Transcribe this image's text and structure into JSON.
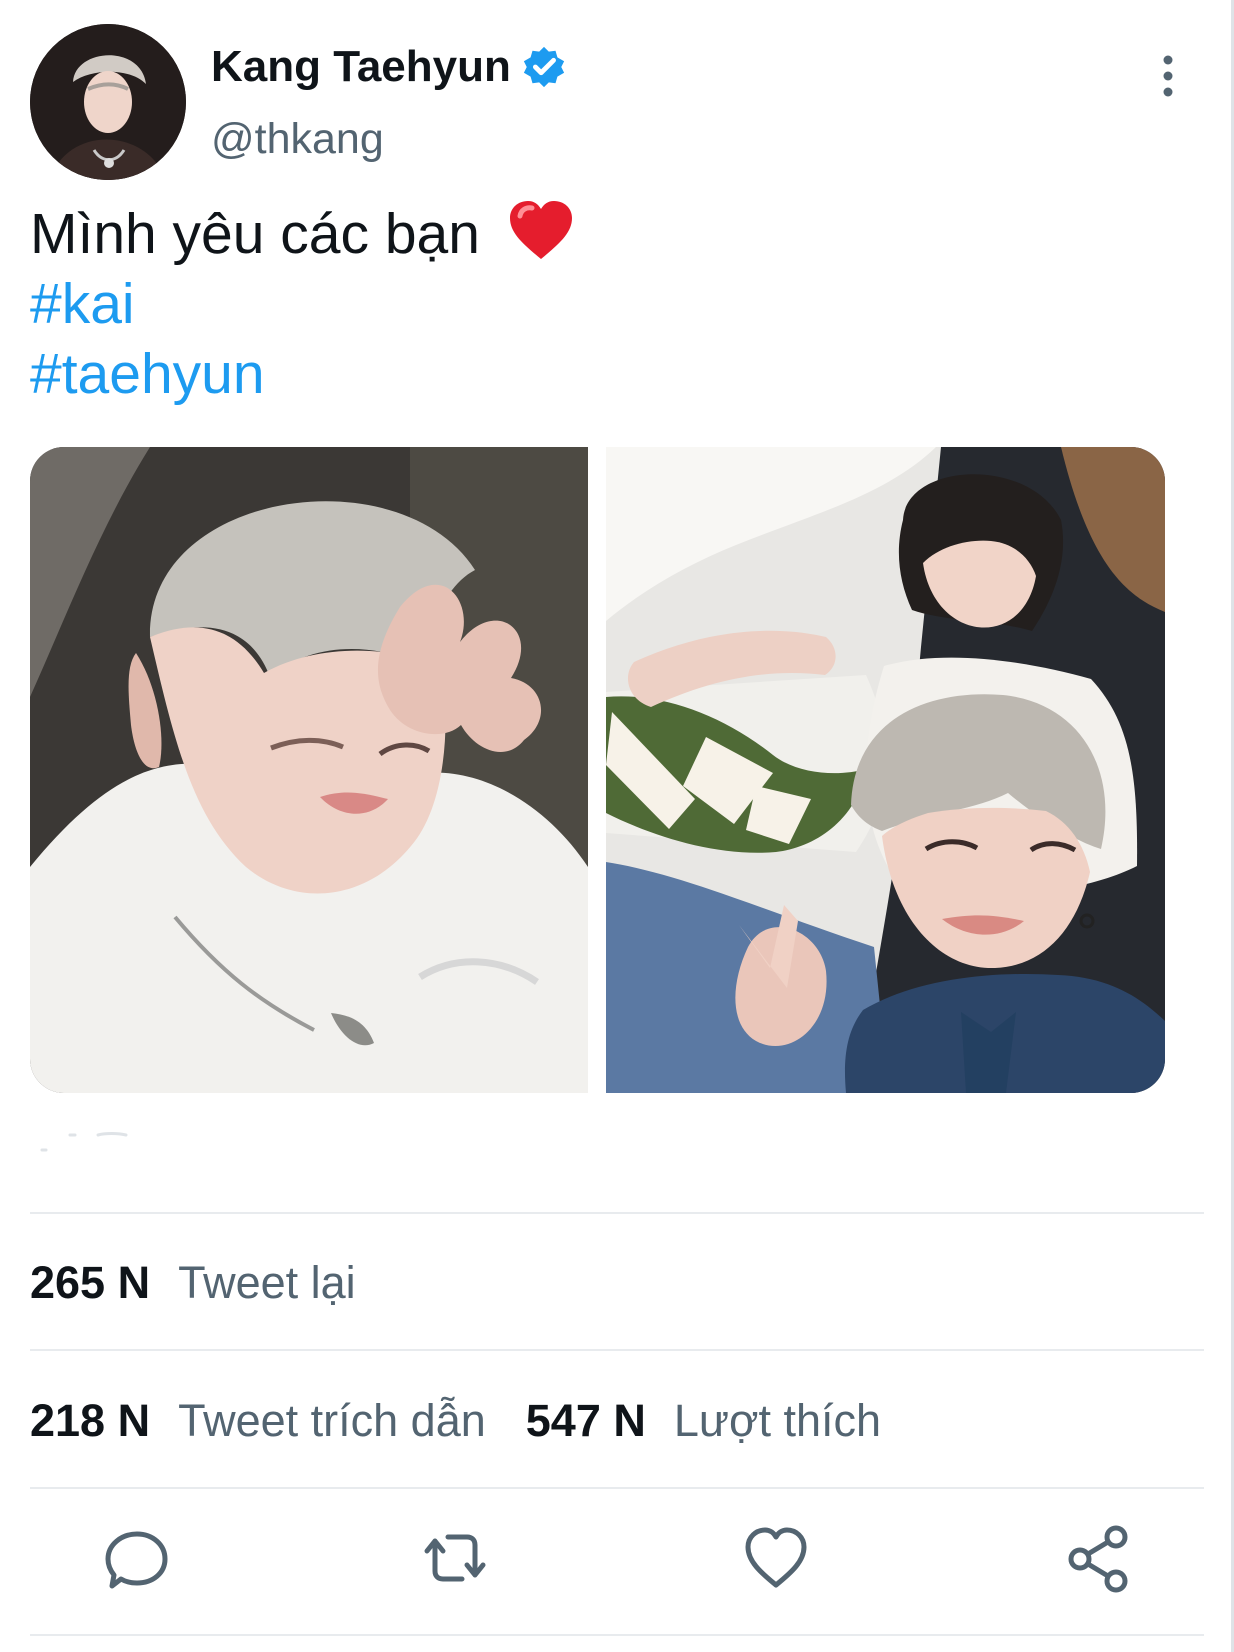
{
  "tweet": {
    "author": {
      "display_name": "Kang Taehyun",
      "handle": "@thkang",
      "verified": true
    },
    "text": {
      "line1": "Mình yêu các bạn",
      "emoji": "red-heart-emoji",
      "hashtags": [
        "#kai",
        "#taehyun"
      ]
    },
    "media": [
      {
        "icon": "selfie-photo"
      },
      {
        "icon": "two-person-selfie-photo"
      }
    ],
    "stats": {
      "retweets_value": "265 N",
      "retweets_label": "Tweet lại",
      "quotes_value": "218 N",
      "quotes_label": "Tweet trích dẫn",
      "likes_value": "547 N",
      "likes_label": "Lượt thích"
    }
  },
  "actions": {
    "reply_icon": "reply-icon",
    "retweet_icon": "retweet-icon",
    "like_icon": "heart-icon",
    "share_icon": "share-icon"
  },
  "colors": {
    "link": "#1d9bf0",
    "secondary_text": "#536471",
    "primary_text": "#0f1419",
    "divider": "#e8ebee"
  }
}
